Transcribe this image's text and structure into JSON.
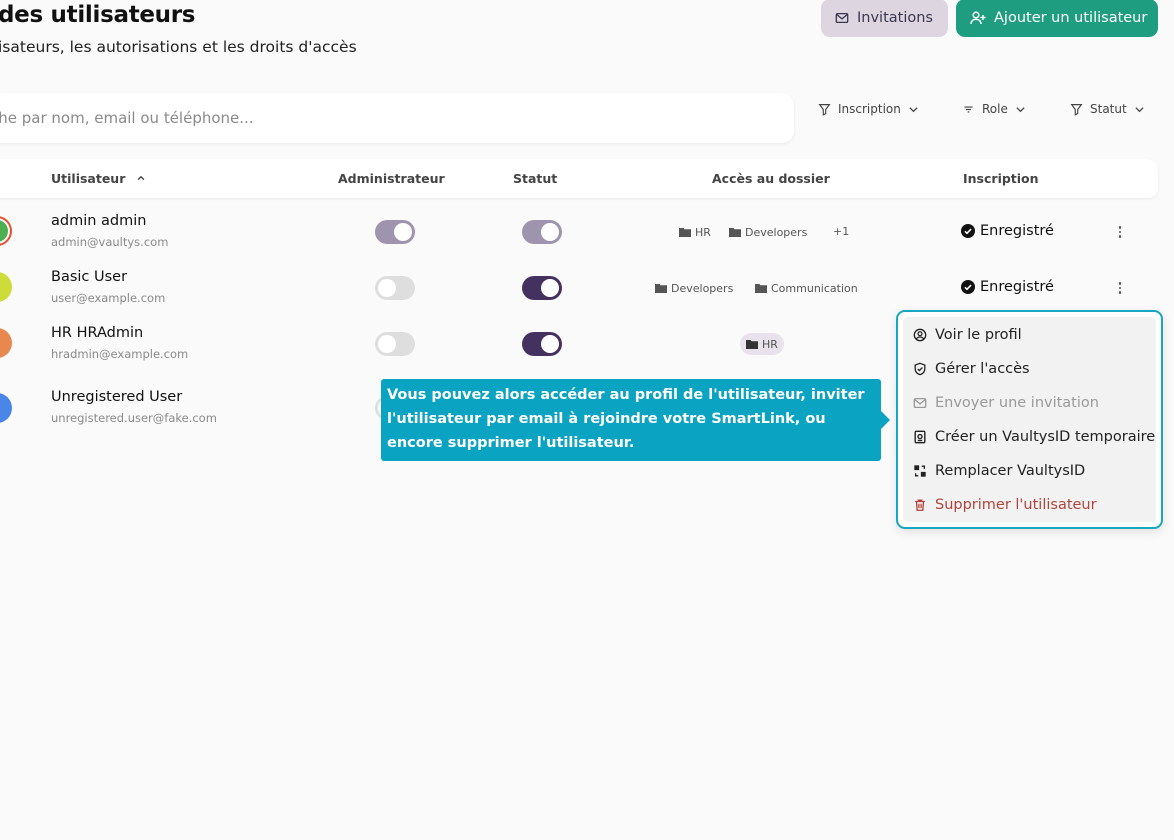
{
  "header": {
    "title": "des utilisateurs",
    "subtitle": "isateurs, les autorisations et les droits d'accès",
    "invitations_label": "Invitations",
    "add_user_label": "Ajouter un utilisateur"
  },
  "search": {
    "placeholder": "che par nom, email ou téléphone..."
  },
  "filters": {
    "inscription": "Inscription",
    "role": "Role",
    "statut": "Statut"
  },
  "table": {
    "columns": {
      "user": "Utilisateur",
      "admin": "Administrateur",
      "status": "Statut",
      "folder_access": "Accès au dossier",
      "registration": "Inscription"
    },
    "rows": [
      {
        "name": "admin admin",
        "email": "admin@vaultys.com",
        "avatar_color": "#4caf50",
        "admin_on": true,
        "status_on": true,
        "folders": [
          "HR",
          "Developers"
        ],
        "more": "+1",
        "registration": "Enregistré"
      },
      {
        "name": "Basic User",
        "email": "user@example.com",
        "avatar_color": "#cddc39",
        "admin_on": false,
        "status_on": true,
        "folders": [
          "Developers",
          "Communication"
        ],
        "registration": "Enregistré"
      },
      {
        "name": "HR HRAdmin",
        "email": "hradmin@example.com",
        "avatar_color": "#e8884e",
        "admin_on": false,
        "status_on": true,
        "folders": [
          "HR"
        ]
      },
      {
        "name": "Unregistered User",
        "email": "unregistered.user@fake.com",
        "avatar_color": "#4a86e8"
      }
    ]
  },
  "tooltip": {
    "text": "Vous pouvez alors accéder au profil de l'utilisateur, inviter l'utilisateur par email à rejoindre votre SmartLink, ou encore supprimer l'utilisateur."
  },
  "menu": {
    "items": [
      {
        "label": "Voir le profil",
        "icon": "user-circle-icon"
      },
      {
        "label": "Gérer l'accès",
        "icon": "shield-icon"
      },
      {
        "label": "Envoyer une invitation",
        "icon": "mail-icon",
        "disabled": true
      },
      {
        "label": "Créer un VaultysID temporaire",
        "icon": "id-badge-icon"
      },
      {
        "label": "Remplacer VaultysID",
        "icon": "swap-icon"
      },
      {
        "label": "Supprimer l'utilisateur",
        "icon": "trash-icon",
        "danger": true
      }
    ]
  },
  "colors": {
    "accent": "#1f9d80",
    "tooltip": "#0aa3c2",
    "toggle_on": "#45315f",
    "danger": "#b0443c"
  }
}
